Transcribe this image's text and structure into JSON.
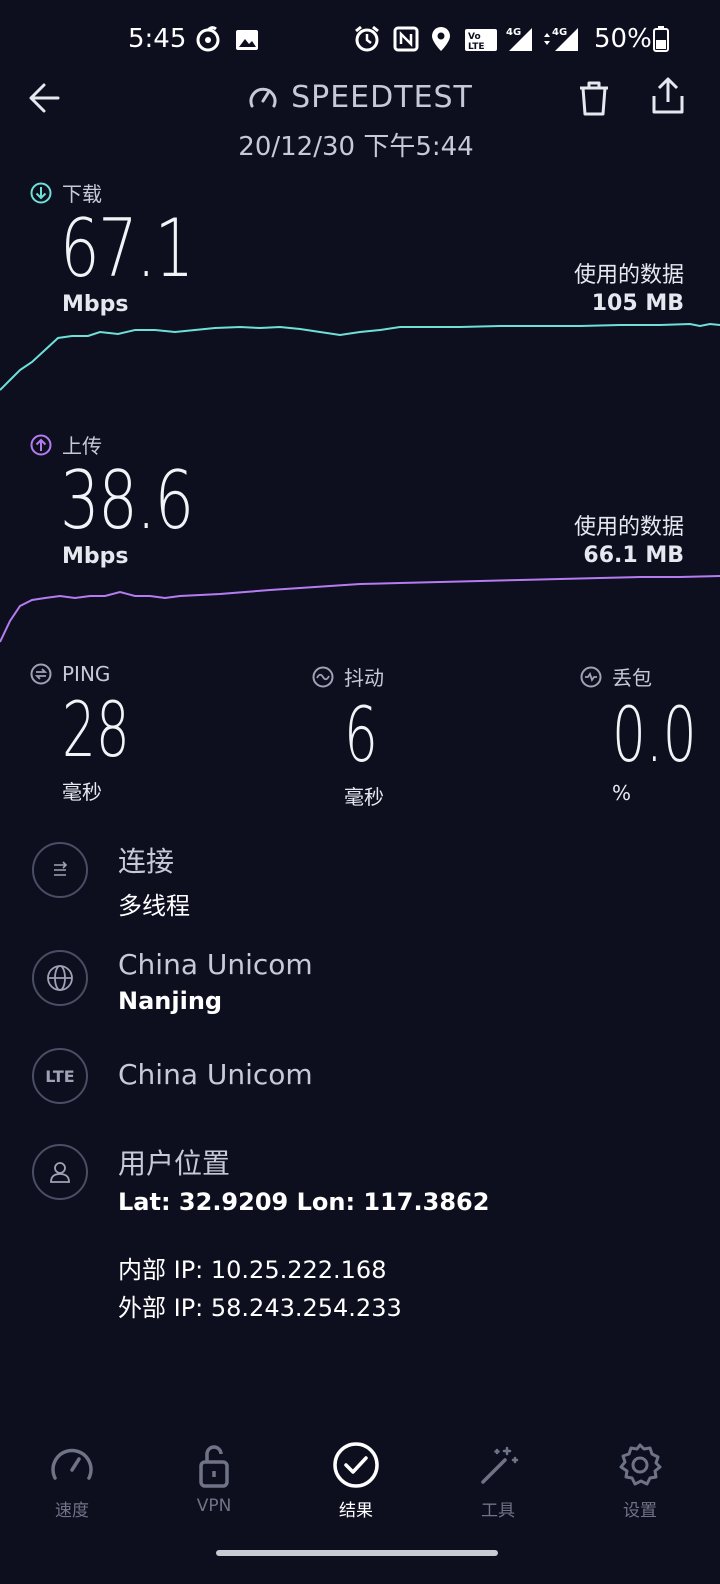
{
  "status_bar": {
    "time": "5:45",
    "battery": "50%",
    "icons": [
      "netease-music-icon",
      "image-icon",
      "alarm-icon",
      "nfc-icon",
      "location-icon",
      "volte-icon",
      "signal-4g-icon",
      "signal-4g-icon",
      "battery-icon"
    ],
    "volte_text": "Vo LTE",
    "net_label": "4G"
  },
  "header": {
    "title": "SPEEDTEST",
    "subtitle": "20/12/30 下午5:44"
  },
  "download": {
    "label": "下载",
    "value": "67.1",
    "unit": "Mbps",
    "data_used_label": "使用的数据",
    "data_used_value": "105 MB",
    "color": "#6ee0d8"
  },
  "upload": {
    "label": "上传",
    "value": "38.6",
    "unit": "Mbps",
    "data_used_label": "使用的数据",
    "data_used_value": "66.1 MB",
    "color": "#b57cf2"
  },
  "metrics": {
    "ping": {
      "label": "PING",
      "value": "28",
      "unit": "毫秒"
    },
    "jitter": {
      "label": "抖动",
      "value": "6",
      "unit": "毫秒"
    },
    "loss": {
      "label": "丢包",
      "value": "0.0",
      "unit": "%"
    }
  },
  "info": {
    "connection": {
      "primary": "连接",
      "secondary": "多线程"
    },
    "server": {
      "primary": "China Unicom",
      "secondary": "Nanjing"
    },
    "carrier": {
      "primary": "China Unicom",
      "icon_text": "LTE"
    },
    "location": {
      "primary": "用户位置",
      "secondary": "Lat: 32.9209 Lon: 117.3862"
    },
    "internal_ip": "内部 IP: 10.25.222.168",
    "external_ip": "外部 IP: 58.243.254.233"
  },
  "nav": {
    "speed": "速度",
    "vpn": "VPN",
    "results": "结果",
    "tools": "工具",
    "settings": "设置"
  }
}
